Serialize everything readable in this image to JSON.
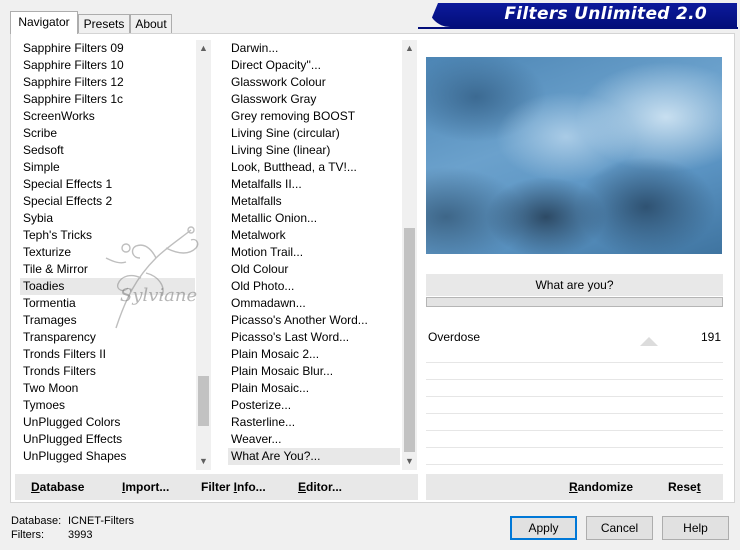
{
  "window": {
    "title": "Filters Unlimited 2.0"
  },
  "tabs": [
    {
      "label": "Navigator",
      "active": true
    },
    {
      "label": "Presets",
      "active": false
    },
    {
      "label": "About",
      "active": false
    }
  ],
  "categories": {
    "items": [
      "Sapphire Filters 09",
      "Sapphire Filters 10",
      "Sapphire Filters 12",
      "Sapphire Filters 1c",
      "ScreenWorks",
      "Scribe",
      "Sedsoft",
      "Simple",
      "Special Effects 1",
      "Special Effects 2",
      "Sybia",
      "Teph's Tricks",
      "Texturize",
      "Tile & Mirror",
      "Toadies",
      "Tormentia",
      "Tramages",
      "Transparency",
      "Tronds Filters II",
      "Tronds Filters",
      "Two Moon",
      "Tymoes",
      "UnPlugged Colors",
      "UnPlugged Effects",
      "UnPlugged Shapes"
    ],
    "selected_index": 14,
    "scroll_position": 0.86
  },
  "filters": {
    "items": [
      "Darwin...",
      "Direct Opacity''...",
      "Glasswork Colour",
      "Glasswork Gray",
      "Grey removing BOOST",
      "Living Sine (circular)",
      "Living Sine (linear)",
      "Look, Butthead, a TV!...",
      "Metalfalls II...",
      "Metalfalls",
      "Metallic Onion...",
      "Metalwork",
      "Motion Trail...",
      "Old Colour",
      "Old Photo...",
      "Ommadawn...",
      "Picasso's Another Word...",
      "Picasso's Last Word...",
      "Plain Mosaic 2...",
      "Plain Mosaic Blur...",
      "Plain Mosaic...",
      "Posterize...",
      "Rasterline...",
      "Weaver...",
      "What Are You?..."
    ],
    "selected_index": 24,
    "scroll_position": 1.0
  },
  "watermark": {
    "text": "Sylviane"
  },
  "preview": {
    "question": "What are you?"
  },
  "sliders": [
    {
      "label": "Overdose",
      "value": "191"
    }
  ],
  "left_buttons": {
    "database": {
      "underlined": "D",
      "rest": "atabase"
    },
    "import": {
      "underlined": "I",
      "rest": "mport..."
    },
    "filter_info": {
      "before": "Filter ",
      "underlined": "I",
      "rest": "nfo..."
    },
    "editor": {
      "underlined": "E",
      "rest": "ditor..."
    }
  },
  "right_buttons": {
    "randomize": {
      "underlined": "R",
      "rest": "andomize"
    },
    "reset": {
      "before": "Rese",
      "underlined": "t",
      "rest": ""
    }
  },
  "status": {
    "database_label": "Database:",
    "database_value": "ICNET-Filters",
    "filters_label": "Filters:",
    "filters_value": "3993"
  },
  "dialog_buttons": {
    "apply": "Apply",
    "cancel": "Cancel",
    "help": "Help"
  }
}
